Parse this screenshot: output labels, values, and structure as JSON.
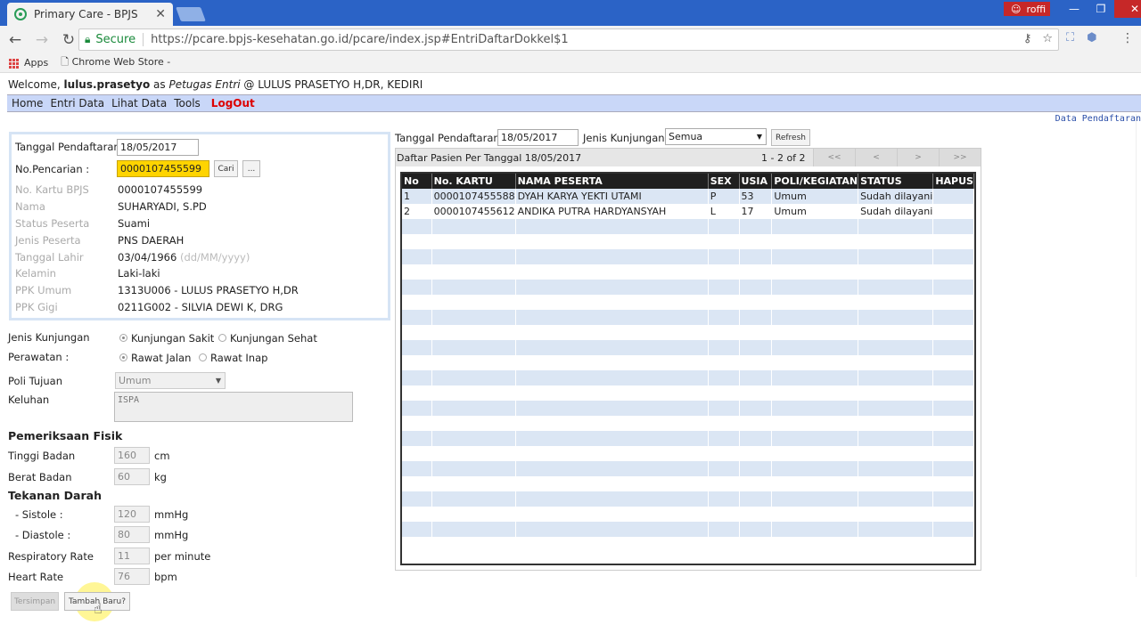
{
  "browser": {
    "tab_title": "Primary Care - BPJS",
    "tab_close": "✕",
    "user_badge": "roffi",
    "win_min": "—",
    "win_max": "❐",
    "win_close": "✕",
    "secure_label": "Secure",
    "url": "https://pcare.bpjs-kesehatan.go.id/pcare/index.jsp#EntriDaftarDokkel$1",
    "bookmarks": [
      "Apps",
      "Chrome Web Store -"
    ]
  },
  "welcome": {
    "prefix": "Welcome, ",
    "user": "lulus.prasetyo",
    "as": " as ",
    "role": "Petugas Entri",
    "suffix": " @ LULUS PRASETYO H,DR, KEDIRI"
  },
  "menu": {
    "items": [
      "Home",
      "Entri Data",
      "Lihat Data",
      "Tools"
    ],
    "logout": "LogOut"
  },
  "page_caption": "Data Pendaftaran",
  "form": {
    "tanggal_label": "Tanggal Pendaftaran",
    "tanggal_value": "18/05/2017",
    "pencarian_label": "No.Pencarian :",
    "pencarian_value": "0000107455599",
    "cari_btn": "Cari",
    "more_btn": "...",
    "fields": [
      {
        "label": "No. Kartu BPJS",
        "value": "0000107455599"
      },
      {
        "label": "Nama",
        "value": "SUHARYADI, S.PD"
      },
      {
        "label": "Status Peserta",
        "value": "Suami"
      },
      {
        "label": "Jenis Peserta",
        "value": "PNS DAERAH"
      },
      {
        "label": "Tanggal Lahir",
        "value": "03/04/1966"
      },
      {
        "label": "Kelamin",
        "value": "Laki-laki"
      },
      {
        "label": "PPK Umum",
        "value": "1313U006 - LULUS PRASETYO H,DR"
      },
      {
        "label": "PPK Gigi",
        "value": "0211G002 - SILVIA DEWI K, DRG"
      }
    ],
    "date_hint": "(dd/MM/yyyy)",
    "jenis_kunjungan_label": "Jenis Kunjungan",
    "kunjungan_sakit": "Kunjungan Sakit",
    "kunjungan_sehat": "Kunjungan Sehat",
    "perawatan_label": "Perawatan :",
    "rawat_jalan": "Rawat Jalan",
    "rawat_inap": "Rawat Inap",
    "poli_label": "Poli Tujuan",
    "poli_value": "Umum",
    "keluhan_label": "Keluhan",
    "keluhan_value": "ISPA",
    "pemeriksaan_heading": "Pemeriksaan Fisik",
    "tinggi_label": "Tinggi Badan",
    "tinggi_value": "160",
    "tinggi_unit": "cm",
    "berat_label": "Berat Badan",
    "berat_value": "60",
    "berat_unit": "kg",
    "tekanan_heading": "Tekanan Darah",
    "sistole_label": "- Sistole :",
    "sistole_value": "120",
    "sistole_unit": "mmHg",
    "diastole_label": "- Diastole :",
    "diastole_value": "80",
    "diastole_unit": "mmHg",
    "resp_label": "Respiratory Rate",
    "resp_value": "11",
    "resp_unit": "per minute",
    "heart_label": "Heart Rate",
    "heart_value": "76",
    "heart_unit": "bpm",
    "tersimpan_btn": "Tersimpan",
    "tambah_btn": "Tambah Baru?"
  },
  "right": {
    "tanggal_label": "Tanggal Pendaftaran",
    "tanggal_value": "18/05/2017",
    "jenis_label": "Jenis Kunjungan",
    "jenis_value": "Semua",
    "refresh_btn": "Refresh",
    "panel_title": "Daftar Pasien Per Tanggal 18/05/2017",
    "paging": "1 - 2 of 2",
    "pager": [
      "<<",
      "<",
      ">",
      ">>"
    ],
    "columns": [
      "No",
      "No. KARTU",
      "NAMA PESERTA",
      "SEX",
      "USIA",
      "POLI/KEGIATAN",
      "STATUS",
      "HAPUS"
    ],
    "rows": [
      [
        "1",
        "0000107455588",
        "DYAH KARYA YEKTI UTAMI",
        "P",
        "53",
        "Umum",
        "Sudah dilayani",
        ""
      ],
      [
        "2",
        "0000107455612",
        "ANDIKA PUTRA HARDYANSYAH",
        "L",
        "17",
        "Umum",
        "Sudah dilayani",
        ""
      ]
    ]
  }
}
